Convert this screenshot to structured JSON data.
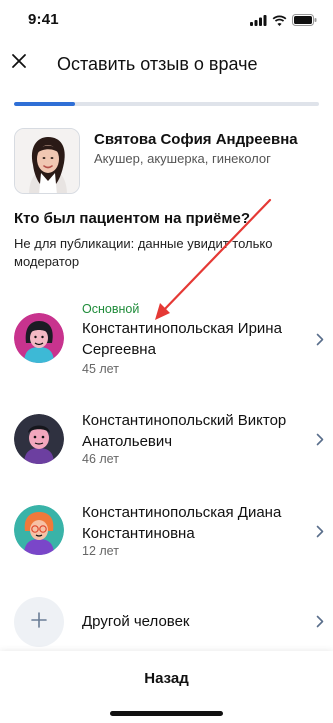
{
  "status_bar": {
    "time": "9:41"
  },
  "header": {
    "title": "Оставить отзыв о враче"
  },
  "progress": {
    "fraction": 0.2
  },
  "doctor": {
    "name": "Святова София Андреевна",
    "specialty": "Акушер, акушерка, гинеколог"
  },
  "question": {
    "title": "Кто был пациентом на приёме?",
    "note": "Не для публикации: данные увидит только модератор"
  },
  "patients": [
    {
      "tag": "Основной",
      "name": "Константинопольская Ирина Сергеевна",
      "age": "45 лет"
    },
    {
      "name": "Константинопольский Виктор Анатольевич",
      "age": "46 лет"
    },
    {
      "name": "Константинопольская Диана Константиновна",
      "age": "12 лет"
    }
  ],
  "add_person": {
    "label": "Другой человек"
  },
  "footer": {
    "back_label": "Назад"
  },
  "colors": {
    "accent": "#2f6fd6",
    "tag_green": "#1f8c3a",
    "annotation_arrow": "#e53935"
  },
  "icons": [
    "signal-icon",
    "wifi-icon",
    "battery-icon",
    "close-icon",
    "chevron-right-icon",
    "plus-icon"
  ]
}
